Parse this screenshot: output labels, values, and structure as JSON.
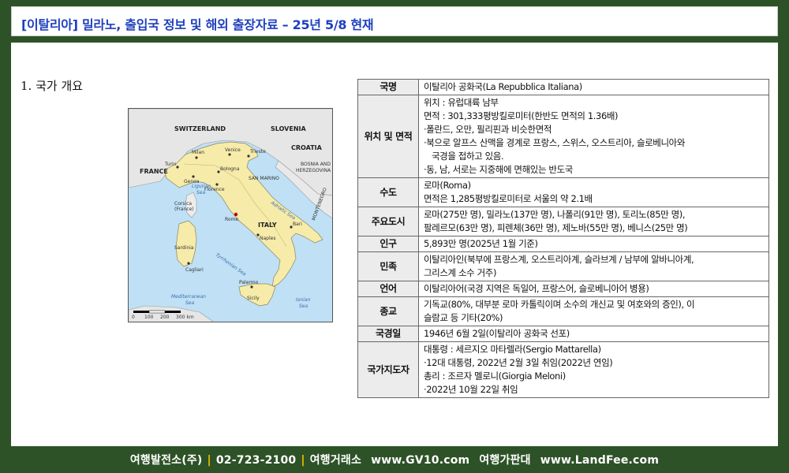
{
  "header": {
    "title": "[이탈리아] 밀라노, 출입국 정보 및 해외 출장자료 – 25년 5/8 현재"
  },
  "section": {
    "title": "1. 국가 개요"
  },
  "map": {
    "labels": {
      "switzerland": "SWITZERLAND",
      "slovenia": "SLOVENIA",
      "croatia": "CROATIA",
      "bosnia": "BOSNIA AND",
      "herzegovina": "HERZEGOVINA",
      "france": "FRANCE",
      "san_marino": "SAN MARINO",
      "italy": "ITALY",
      "montenegro": "MONTENEGRO",
      "ligurian": "Ligurian",
      "ligurian_sea": "Sea",
      "adriatic": "Adriatic Sea",
      "tyrrhenian": "Tyrrhenian Sea",
      "ionian": "Ionian",
      "ionian_sea": "Sea",
      "mediterranean": "Mediterranean",
      "mediterranean_sea": "Sea",
      "corsica": "Corsica",
      "corsica_fr": "(France)",
      "sardinia": "Sardinia",
      "sicily": "Sicily",
      "milan": "Milan",
      "venice": "Venice",
      "turin": "Turin",
      "genoa": "Genoa",
      "bologna": "Bologna",
      "florence": "Florence",
      "rome": "Rome",
      "naples": "Naples",
      "bari": "Bari",
      "palermo": "Palermo",
      "cagliari": "Cagliari",
      "trieste": "Trieste"
    },
    "scale": {
      "s0": "0",
      "s1": "100",
      "s2": "200",
      "s3": "300 km"
    }
  },
  "table": {
    "rows": [
      {
        "key": "국명",
        "lines": [
          "이탈리아 공화국(La Repubblica Italiana)"
        ]
      },
      {
        "key": "위치 및 면적",
        "lines": [
          "위치 : 유럽대륙 남부",
          "면적 : 301,333평방킬로미터(한반도 면적의 1.36배)",
          "·폴란드, 오만, 필리핀과 비슷한면적",
          "·북으로 알프스 산맥을 경계로 프랑스, 스위스, 오스트리아, 슬로베니아와",
          "국경을 접하고 있음.",
          "·동, 남, 서로는 지중해에 면해있는 반도국"
        ]
      },
      {
        "key": "수도",
        "lines": [
          "로마(Roma)",
          "면적은 1,285평방킬로미터로 서울의 약 2.1배"
        ]
      },
      {
        "key": "주요도시",
        "lines": [
          "로마(275만 명), 밀라노(137만 명), 나폴리(91만 명), 토리노(85만 명),",
          "팔레르모(63만 명), 피렌체(36만 명), 제노바(55만 명), 베니스(25만 명)"
        ]
      },
      {
        "key": "인구",
        "lines": [
          "5,893만 명(2025년 1월 기준)"
        ]
      },
      {
        "key": "민족",
        "lines": [
          "이탈리아인(북부에 프랑스계, 오스트리아계, 슬라브계 / 남부에 알바니아계,",
          "그리스계 소수 거주)"
        ]
      },
      {
        "key": "언어",
        "lines": [
          "이탈리아어(국경 지역은 독일어, 프랑스어, 슬로베니아어 병용)"
        ]
      },
      {
        "key": "종교",
        "lines": [
          "기독교(80%, 대부분 로마 카톨릭이며 소수의 개신교 및 여호와의 증인), 이",
          "슬람교 등 기타(20%)"
        ]
      },
      {
        "key": "국경일",
        "lines": [
          "1946년 6월 2일(이탈리아 공화국 선포)"
        ]
      },
      {
        "key": "국가지도자",
        "lines": [
          "대통령 : 세르지오 마타렐라(Sergio Mattarella)",
          "·12대 대통령, 2022년 2월 3일 취임(2022년 연임)",
          "총리 : 조르자 멜로니(Giorgia Meloni)",
          "·2022년 10월 22일 취임"
        ]
      }
    ]
  },
  "footer": {
    "company": "여행발전소(주)",
    "phone": "02-723-2100",
    "agency": "여행거래소",
    "url1": "www.GV10.com",
    "price": "여행가판대",
    "url2": "www.LandFee.com"
  },
  "colors": {
    "background": "#2e5227",
    "title": "#1f3fbf",
    "separator": "#f2c400",
    "italy": "#f6eba9",
    "sea": "#bfe0f5"
  }
}
